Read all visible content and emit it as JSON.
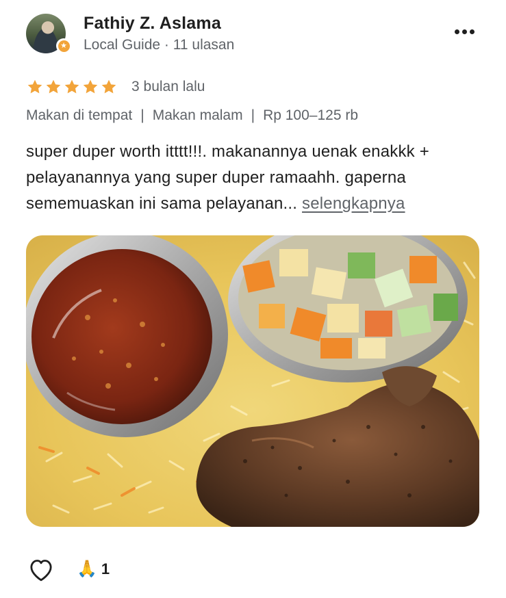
{
  "reviewer": {
    "name": "Fathiy Z. Aslama",
    "role": "Local Guide",
    "separator": " · ",
    "review_count": "11 ulasan",
    "badge_icon": "local-guide-star-icon",
    "badge_color": "#f2a43a"
  },
  "menu": {
    "icon": "more-options-icon"
  },
  "rating": {
    "stars": 5,
    "max": 5,
    "star_color": "#f2a43a",
    "time": "3 bulan lalu"
  },
  "tags": [
    "Makan di tempat",
    "Makan malam",
    "Rp 100–125 rb"
  ],
  "tag_separator": "|",
  "review": {
    "text": "super duper worth itttt!!!. makanannya uenak enakkk + pelayanannya yang super duper ramaahh. gaperna sememuaskan ini sama pelayanan...",
    "more_label": "selengkapnya"
  },
  "photo": {
    "description_icon": "food-photo"
  },
  "actions": {
    "like_icon": "heart-outline-icon",
    "reaction_emoji": "🙏",
    "reaction_count": "1"
  },
  "colors": {
    "text": "#1f1f1f",
    "secondary": "#5f6368",
    "star": "#f2a43a"
  }
}
